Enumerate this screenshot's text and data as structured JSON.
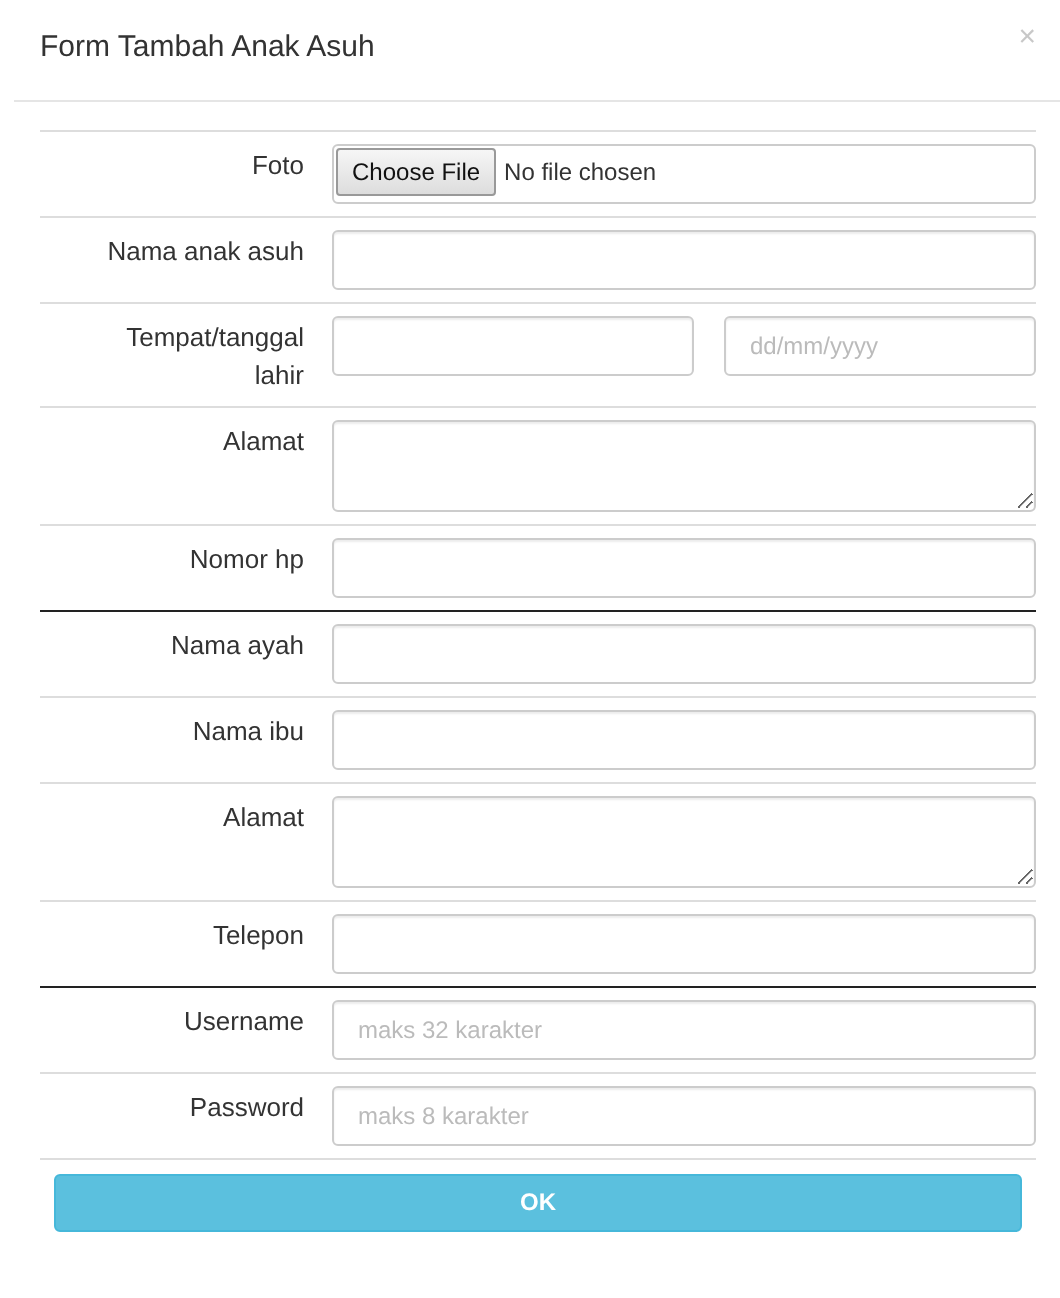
{
  "modal": {
    "title": "Form Tambah Anak Asuh",
    "close": "×"
  },
  "sections": [
    [
      {
        "kind": "file",
        "label": "Foto",
        "button": "Choose File",
        "status": "No file chosen"
      },
      {
        "kind": "text",
        "label": "Nama anak asuh"
      },
      {
        "kind": "pair",
        "label": "Tempat/tanggal lahir",
        "date_placeholder": "dd/mm/yyyy"
      },
      {
        "kind": "textarea",
        "label": "Alamat"
      },
      {
        "kind": "text",
        "label": "Nomor hp"
      }
    ],
    [
      {
        "kind": "text",
        "label": "Nama ayah"
      },
      {
        "kind": "text",
        "label": "Nama ibu"
      },
      {
        "kind": "textarea",
        "label": "Alamat"
      },
      {
        "kind": "text",
        "label": "Telepon"
      }
    ],
    [
      {
        "kind": "text",
        "label": "Username",
        "placeholder": "maks 32 karakter"
      },
      {
        "kind": "text",
        "label": "Password",
        "placeholder": "maks 8 karakter"
      }
    ]
  ],
  "submit": "OK"
}
